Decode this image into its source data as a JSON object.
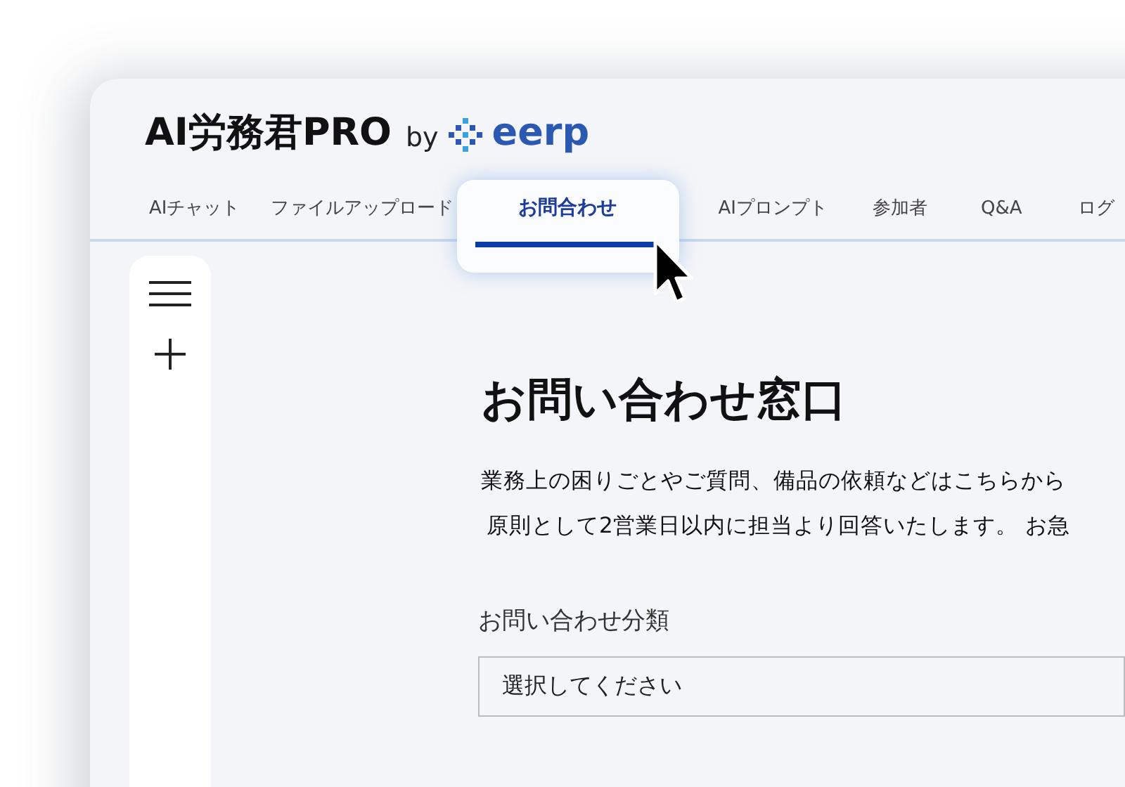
{
  "logo": {
    "name": "AI労務君PRO",
    "by": "by",
    "brand": "eerp"
  },
  "tabs": [
    {
      "label": "AIチャット",
      "selected": false
    },
    {
      "label": "ファイルアップロード",
      "selected": false
    },
    {
      "label": "お問合わせ",
      "selected": true
    },
    {
      "label": "AIプロンプト",
      "selected": false
    },
    {
      "label": "参加者",
      "selected": false
    },
    {
      "label": "Q&A",
      "selected": false
    },
    {
      "label": "ログ",
      "selected": false
    }
  ],
  "page": {
    "title": "お問い合わせ窓口",
    "description": [
      "業務上の困りごとやご質問、備品の依頼などはこちらから",
      "原則として2営業日以内に担当より回答いたします。 お急"
    ],
    "fields": [
      {
        "label": "お問い合わせ分類",
        "value": "選択してください"
      }
    ]
  }
}
